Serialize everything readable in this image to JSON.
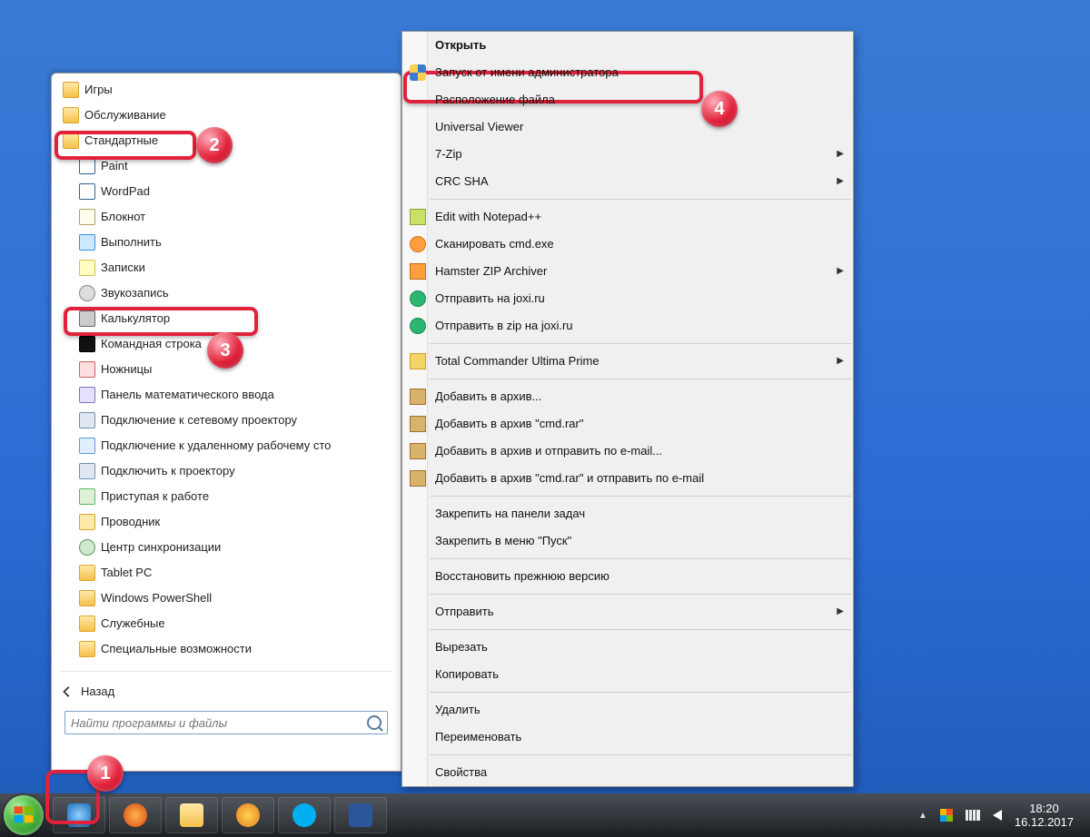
{
  "colors": {
    "callout": "#e2223a"
  },
  "start_menu": {
    "back_label": "Назад",
    "search_placeholder": "Найти программы и файлы",
    "items": [
      {
        "label": "Игры",
        "type": "folder",
        "indent": 0
      },
      {
        "label": "Обслуживание",
        "type": "folder",
        "indent": 0,
        "obscured": true
      },
      {
        "label": "Стандартные",
        "type": "folder",
        "indent": 0,
        "callout": 2
      },
      {
        "label": "Paint",
        "type": "app",
        "icon": "paint",
        "indent": 1
      },
      {
        "label": "WordPad",
        "type": "app",
        "icon": "wordpad",
        "indent": 1
      },
      {
        "label": "Блокнот",
        "type": "app",
        "icon": "notepad",
        "indent": 1
      },
      {
        "label": "Выполнить",
        "type": "app",
        "icon": "run",
        "indent": 1
      },
      {
        "label": "Записки",
        "type": "app",
        "icon": "sticky",
        "indent": 1
      },
      {
        "label": "Звукозапись",
        "type": "app",
        "icon": "mic",
        "indent": 1
      },
      {
        "label": "Калькулятор",
        "type": "app",
        "icon": "calc",
        "indent": 1,
        "obscured": true
      },
      {
        "label": "Командная строка",
        "type": "app",
        "icon": "cmd",
        "indent": 1,
        "callout": 3
      },
      {
        "label": "Ножницы",
        "type": "app",
        "icon": "snip",
        "indent": 1,
        "obscured": true
      },
      {
        "label": "Панель математического ввода",
        "type": "app",
        "icon": "math",
        "indent": 1
      },
      {
        "label": "Подключение к сетевому проектору",
        "type": "app",
        "icon": "proj",
        "indent": 1
      },
      {
        "label": "Подключение к удаленному рабочему сто",
        "type": "app",
        "icon": "rdp",
        "indent": 1
      },
      {
        "label": "Подключить к проектору",
        "type": "app",
        "icon": "proj",
        "indent": 1
      },
      {
        "label": "Приступая к работе",
        "type": "app",
        "icon": "start",
        "indent": 1
      },
      {
        "label": "Проводник",
        "type": "app",
        "icon": "explorer",
        "indent": 1
      },
      {
        "label": "Центр синхронизации",
        "type": "app",
        "icon": "sync",
        "indent": 1
      },
      {
        "label": "Tablet PC",
        "type": "folder",
        "indent": 1
      },
      {
        "label": "Windows PowerShell",
        "type": "folder",
        "indent": 1
      },
      {
        "label": "Служебные",
        "type": "folder",
        "indent": 1
      },
      {
        "label": "Специальные возможности",
        "type": "folder",
        "indent": 1
      }
    ]
  },
  "context_menu": {
    "groups": [
      [
        {
          "label": "Открыть",
          "bold": true
        },
        {
          "label": "Запуск от имени администратора",
          "icon": "shield",
          "callout": 4
        },
        {
          "label": "Расположение файла"
        },
        {
          "label": "Universal Viewer"
        },
        {
          "label": "7-Zip",
          "submenu": true
        },
        {
          "label": "CRC SHA",
          "submenu": true
        }
      ],
      [
        {
          "label": "Edit with Notepad++",
          "icon": "np"
        },
        {
          "label": "Сканировать cmd.exe",
          "icon": "av"
        },
        {
          "label": "Hamster ZIP Archiver",
          "icon": "hz",
          "submenu": true
        },
        {
          "label": "Отправить на joxi.ru",
          "icon": "jx"
        },
        {
          "label": "Отправить в zip на joxi.ru",
          "icon": "jx"
        }
      ],
      [
        {
          "label": "Total Commander Ultima Prime",
          "icon": "tc",
          "submenu": true
        }
      ],
      [
        {
          "label": "Добавить в архив...",
          "icon": "wr"
        },
        {
          "label": "Добавить в архив \"cmd.rar\"",
          "icon": "wr"
        },
        {
          "label": "Добавить в архив и отправить по e-mail...",
          "icon": "wr"
        },
        {
          "label": "Добавить в архив \"cmd.rar\" и отправить по e-mail",
          "icon": "wr"
        }
      ],
      [
        {
          "label": "Закрепить на панели задач"
        },
        {
          "label": "Закрепить в меню \"Пуск\""
        }
      ],
      [
        {
          "label": "Восстановить прежнюю версию"
        }
      ],
      [
        {
          "label": "Отправить",
          "submenu": true
        }
      ],
      [
        {
          "label": "Вырезать"
        },
        {
          "label": "Копировать"
        }
      ],
      [
        {
          "label": "Удалить"
        },
        {
          "label": "Переименовать"
        }
      ],
      [
        {
          "label": "Свойства"
        }
      ]
    ]
  },
  "taskbar": {
    "pinned": [
      "ie",
      "ff",
      "ex",
      "wmp",
      "sk",
      "wd"
    ],
    "tray": {
      "time": "18:20",
      "date": "16.12.2017",
      "up": "▲"
    }
  },
  "callouts": [
    "1",
    "2",
    "3",
    "4"
  ]
}
